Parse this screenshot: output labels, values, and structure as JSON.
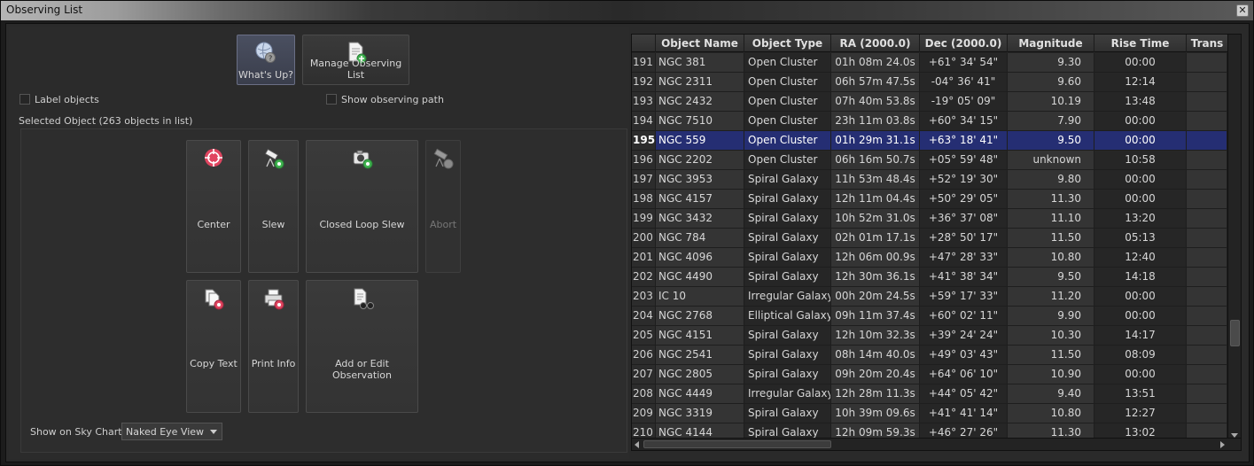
{
  "window": {
    "title": "Observing List",
    "close_glyph": "✕"
  },
  "toolbar": {
    "whats_up": {
      "label": "What's Up?",
      "icon": "globe-question-icon"
    },
    "manage_list": {
      "label": "Manage Observing List",
      "icon": "document-add-icon"
    }
  },
  "options": {
    "label_objects": "Label objects",
    "show_path": "Show observing path"
  },
  "selected_object": {
    "label": "Selected Object (263 objects in list)"
  },
  "commands": {
    "center": "Center",
    "slew": "Slew",
    "closed_loop_slew": "Closed Loop Slew",
    "abort": "Abort",
    "copy_text": "Copy Text",
    "print_info": "Print Info",
    "add_edit_observation": "Add or Edit Observation"
  },
  "sky_chart": {
    "label": "Show on Sky Chart:",
    "value": "Naked Eye View"
  },
  "table": {
    "columns": [
      "Object Name",
      "Object Type",
      "RA (2000.0)",
      "Dec (2000.0)",
      "Magnitude",
      "Rise Time",
      "Trans"
    ],
    "selected_row": 195,
    "rows": [
      {
        "n": "191",
        "name": "NGC 381",
        "type": "Open Cluster",
        "ra": "01h 08m 24.0s",
        "dec": "+61° 34' 54\"",
        "mag": "9.30",
        "rise": "00:00"
      },
      {
        "n": "192",
        "name": "NGC 2311",
        "type": "Open Cluster",
        "ra": "06h 57m 47.5s",
        "dec": "-04° 36' 41\"",
        "mag": "9.60",
        "rise": "12:14"
      },
      {
        "n": "193",
        "name": "NGC 2432",
        "type": "Open Cluster",
        "ra": "07h 40m 53.8s",
        "dec": "-19° 05' 09\"",
        "mag": "10.19",
        "rise": "13:48"
      },
      {
        "n": "194",
        "name": "NGC 7510",
        "type": "Open Cluster",
        "ra": "23h 11m 03.8s",
        "dec": "+60° 34' 15\"",
        "mag": "7.90",
        "rise": "00:00"
      },
      {
        "n": "195",
        "name": "NGC 559",
        "type": "Open Cluster",
        "ra": "01h 29m 31.1s",
        "dec": "+63° 18' 41\"",
        "mag": "9.50",
        "rise": "00:00"
      },
      {
        "n": "196",
        "name": "NGC 2202",
        "type": "Open Cluster",
        "ra": "06h 16m 50.7s",
        "dec": "+05° 59' 48\"",
        "mag": "unknown",
        "rise": "10:58"
      },
      {
        "n": "197",
        "name": "NGC 3953",
        "type": "Spiral Galaxy",
        "ra": "11h 53m 48.4s",
        "dec": "+52° 19' 30\"",
        "mag": "9.80",
        "rise": "00:00"
      },
      {
        "n": "198",
        "name": "NGC 4157",
        "type": "Spiral Galaxy",
        "ra": "12h 11m 04.4s",
        "dec": "+50° 29' 05\"",
        "mag": "11.30",
        "rise": "00:00"
      },
      {
        "n": "199",
        "name": "NGC 3432",
        "type": "Spiral Galaxy",
        "ra": "10h 52m 31.0s",
        "dec": "+36° 37' 08\"",
        "mag": "11.10",
        "rise": "13:20"
      },
      {
        "n": "200",
        "name": "NGC 784",
        "type": "Spiral Galaxy",
        "ra": "02h 01m 17.1s",
        "dec": "+28° 50' 17\"",
        "mag": "11.50",
        "rise": "05:13"
      },
      {
        "n": "201",
        "name": "NGC 4096",
        "type": "Spiral Galaxy",
        "ra": "12h 06m 00.9s",
        "dec": "+47° 28' 33\"",
        "mag": "10.80",
        "rise": "12:40"
      },
      {
        "n": "202",
        "name": "NGC 4490",
        "type": "Spiral Galaxy",
        "ra": "12h 30m 36.1s",
        "dec": "+41° 38' 34\"",
        "mag": "9.50",
        "rise": "14:18"
      },
      {
        "n": "203",
        "name": "IC 10",
        "type": "Irregular Galaxy",
        "ra": "00h 20m 24.5s",
        "dec": "+59° 17' 33\"",
        "mag": "11.20",
        "rise": "00:00"
      },
      {
        "n": "204",
        "name": "NGC 2768",
        "type": "Elliptical Galaxy",
        "ra": "09h 11m 37.4s",
        "dec": "+60° 02' 11\"",
        "mag": "9.90",
        "rise": "00:00"
      },
      {
        "n": "205",
        "name": "NGC 4151",
        "type": "Spiral Galaxy",
        "ra": "12h 10m 32.3s",
        "dec": "+39° 24' 24\"",
        "mag": "10.30",
        "rise": "14:17"
      },
      {
        "n": "206",
        "name": "NGC 2541",
        "type": "Spiral Galaxy",
        "ra": "08h 14m 40.0s",
        "dec": "+49° 03' 43\"",
        "mag": "11.50",
        "rise": "08:09"
      },
      {
        "n": "207",
        "name": "NGC 2805",
        "type": "Spiral Galaxy",
        "ra": "09h 20m 20.4s",
        "dec": "+64° 06' 10\"",
        "mag": "10.90",
        "rise": "00:00"
      },
      {
        "n": "208",
        "name": "NGC 4449",
        "type": "Irregular Galaxy",
        "ra": "12h 28m 11.3s",
        "dec": "+44° 05' 42\"",
        "mag": "9.40",
        "rise": "13:51"
      },
      {
        "n": "209",
        "name": "NGC 3319",
        "type": "Spiral Galaxy",
        "ra": "10h 39m 09.6s",
        "dec": "+41° 41' 14\"",
        "mag": "10.80",
        "rise": "12:27"
      },
      {
        "n": "210",
        "name": "NGC 4144",
        "type": "Spiral Galaxy",
        "ra": "12h 09m 59.3s",
        "dec": "+46° 27' 26\"",
        "mag": "11.30",
        "rise": "13:02"
      }
    ]
  },
  "colors": {
    "selection": "#252e73",
    "background": "#2a2a2a",
    "accent_red": "#e04560",
    "accent_green": "#3fb34f"
  }
}
